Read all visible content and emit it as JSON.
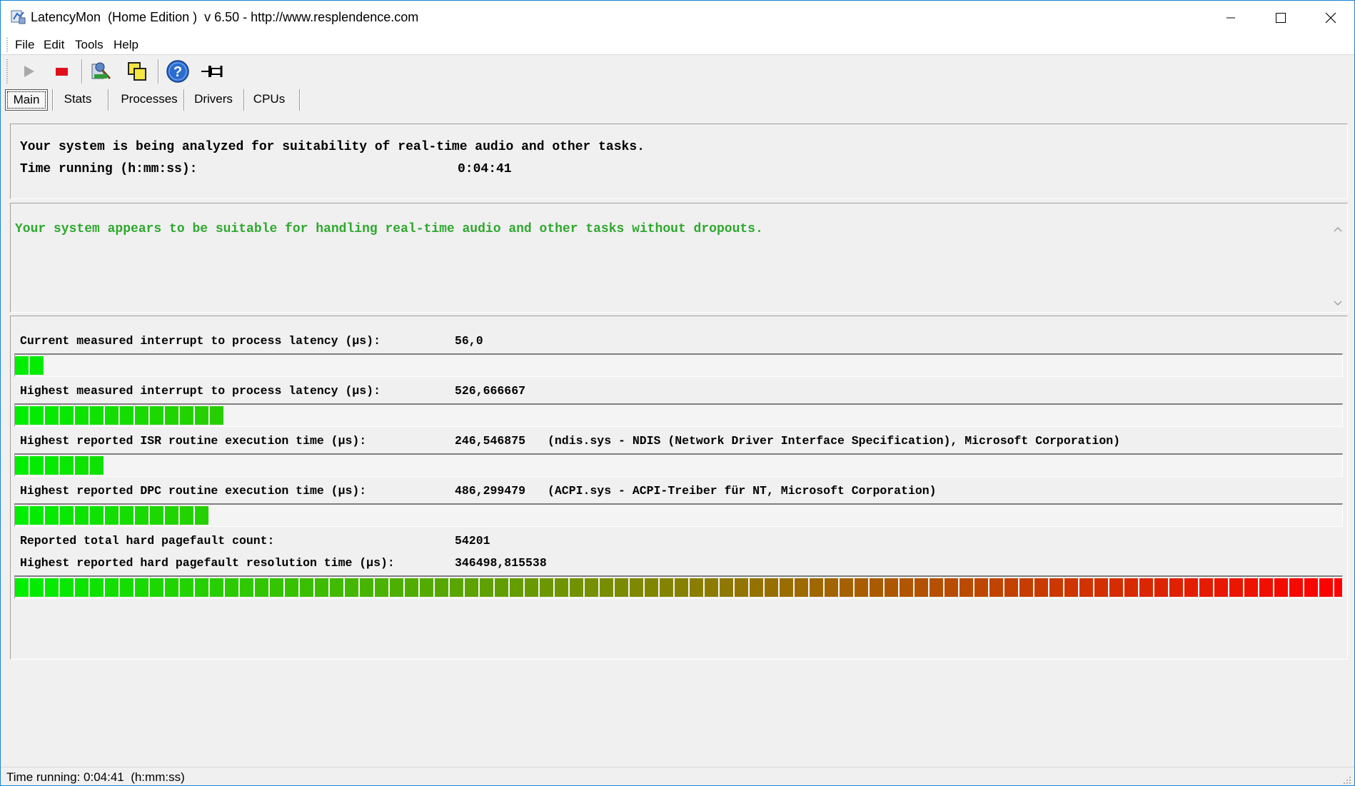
{
  "window": {
    "title": "LatencyMon  (Home Edition )  v 6.50 - http://www.resplendence.com"
  },
  "menu": [
    "File",
    "Edit",
    "Tools",
    "Help"
  ],
  "toolbar": {
    "icons": [
      "play-icon",
      "stop-icon",
      "report-icon",
      "copy-icon",
      "help-icon",
      "pin-icon"
    ]
  },
  "tabs": [
    "Main",
    "Stats",
    "Processes",
    "Drivers",
    "CPUs"
  ],
  "active_tab": "Main",
  "analysis": {
    "line1": "Your system is being analyzed for suitability of real-time audio and other tasks.",
    "time_label": "Time running (h:mm:ss):",
    "time_value": "0:04:41"
  },
  "verdict": {
    "text": "Your system appears to be suitable for handling real-time audio and other tasks without dropouts.",
    "color": "#2ea82e"
  },
  "metrics": [
    {
      "label": "Current measured interrupt to process latency (µs):",
      "value": "56,0",
      "level": 0.012
    },
    {
      "label": "Highest measured interrupt to process latency (µs):",
      "value": "526,666667",
      "level": 0.15
    },
    {
      "label": "Highest reported ISR routine execution time (µs):",
      "value": "246,546875",
      "extra": "(ndis.sys - NDIS (Network Driver Interface Specification), Microsoft Corporation)",
      "level": 0.068
    },
    {
      "label": "Highest reported DPC routine execution time (µs):",
      "value": "486,299479",
      "extra": "(ACPI.sys - ACPI-Treiber für NT, Microsoft Corporation)",
      "level": 0.136
    },
    {
      "label": "Reported total hard pagefault count:",
      "value": "54201"
    },
    {
      "label": "Highest reported hard pagefault resolution time (µs):",
      "value": "346498,815538",
      "level": 1.0
    }
  ],
  "status": {
    "text": "Time running: 0:04:41  (h:mm:ss)"
  },
  "colors": {
    "meter_start": "#00ee00",
    "meter_end": "#ff0000",
    "accent_border": "#1883d7"
  }
}
